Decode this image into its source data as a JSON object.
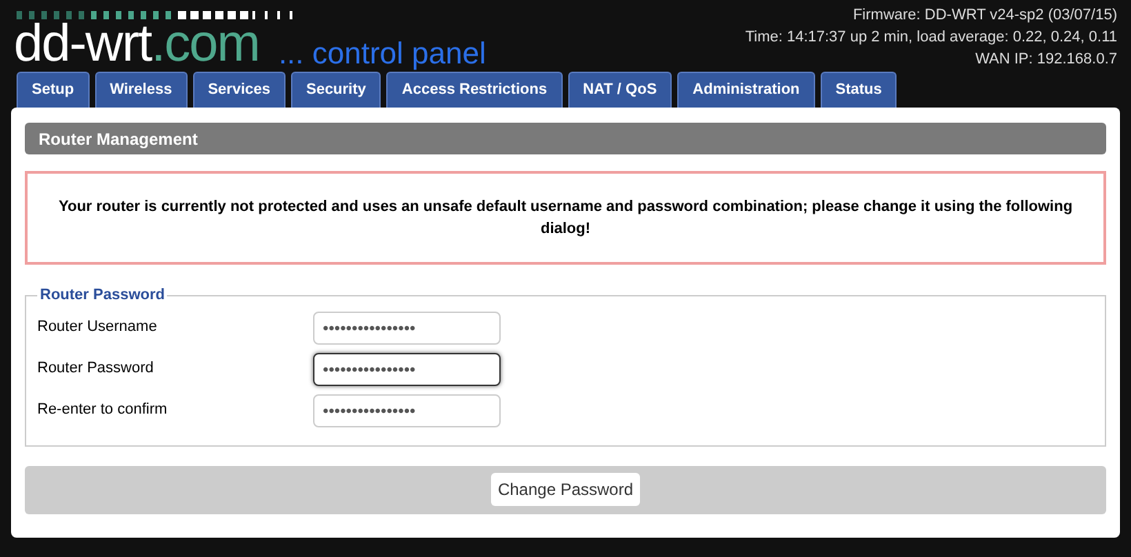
{
  "logo": {
    "brand": "dd-wrt",
    "domain": ".com",
    "tagline": "... control panel"
  },
  "info": [
    "Firmware: DD-WRT v24-sp2 (03/07/15)",
    "Time: 14:17:37 up 2 min, load average: 0.22, 0.24, 0.11",
    "WAN IP: 192.168.0.7"
  ],
  "tabs": [
    "Setup",
    "Wireless",
    "Services",
    "Security",
    "Access Restrictions",
    "NAT / QoS",
    "Administration",
    "Status"
  ],
  "section_title": "Router Management",
  "warning": "Your router is currently not protected and uses an unsafe default username and password combination; please change it using the following dialog!",
  "fieldset": {
    "legend": "Router Password",
    "fields": [
      {
        "label": "Router Username",
        "value": "••••••••••••••••",
        "focused": false
      },
      {
        "label": "Router Password",
        "value": "••••••••••••••••",
        "focused": true
      },
      {
        "label": "Re-enter to confirm",
        "value": "••••••••••••••••",
        "focused": false
      }
    ]
  },
  "button": "Change Password"
}
